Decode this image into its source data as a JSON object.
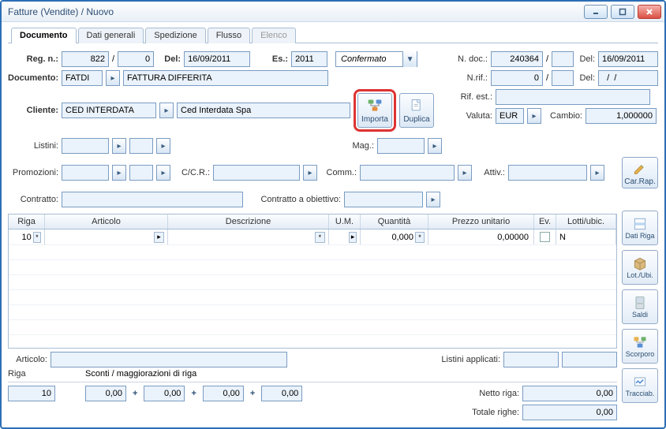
{
  "window": {
    "title": "Fatture  (Vendite) / Nuovo"
  },
  "tabs": {
    "documento": "Documento",
    "dati_generali": "Dati generali",
    "spedizione": "Spedizione",
    "flusso": "Flusso",
    "elenco": "Elenco"
  },
  "header": {
    "labels": {
      "reg_n": "Reg. n.:",
      "del": "Del:",
      "es": "Es.:",
      "documento": "Documento:",
      "cliente": "Cliente:",
      "n_doc": "N. doc.:",
      "n_rif": "N.rif.:",
      "rif_est": "Rif. est.:",
      "valuta": "Valuta:",
      "cambio": "Cambio:"
    },
    "reg_n": "822",
    "reg_n2": "0",
    "del": "16/09/2011",
    "es": "2011",
    "stato": "Confermato",
    "documento_code": "FATDI",
    "documento_desc": "FATTURA DIFFERITA",
    "cliente_code": "CED INTERDATA",
    "cliente_desc": "Ced Interdata Spa",
    "n_doc": "240364",
    "n_doc2": "",
    "del2": "16/09/2011",
    "n_rif": "0",
    "n_rif2": "",
    "del3": "  /  /",
    "rif_est": "",
    "valuta": "EUR",
    "cambio": "1,000000",
    "buttons": {
      "importa": "Importa",
      "duplica": "Duplica"
    }
  },
  "mid": {
    "labels": {
      "listini": "Listini:",
      "mag": "Mag.:",
      "promozioni": "Promozioni:",
      "ccr": "C/C.R.:",
      "comm": "Comm.:",
      "attiv": "Attiv.:",
      "contratto": "Contratto:",
      "contratto_obj": "Contratto a obiettivo:",
      "car_rap": "Car.Rap."
    }
  },
  "grid": {
    "headers": {
      "riga": "Riga",
      "articolo": "Articolo",
      "descrizione": "Descrizione",
      "um": "U.M.",
      "quantita": "Quantità",
      "prezzo": "Prezzo unitario",
      "ev": "Ev.",
      "lotti": "Lotti/ubic."
    },
    "row": {
      "riga": "10",
      "articolo": "",
      "descrizione": "",
      "um": "",
      "quantita": "0,000",
      "prezzo": "0,00000",
      "ev": false,
      "lotti": "N"
    }
  },
  "tools": {
    "dati_riga": "Dati Riga",
    "lot_ubi": "Lot./Ubi.",
    "saldi": "Saldi",
    "scorporo": "Scorporo",
    "tracciab": "Tracciab."
  },
  "footer": {
    "labels": {
      "articolo": "Articolo:",
      "listini_app": "Listini applicati:",
      "riga": "Riga",
      "sconti": "Sconti / maggiorazioni di riga",
      "netto_riga": "Netto riga:",
      "totale_righe": "Totale righe:"
    },
    "articolo": "",
    "riga": "10",
    "s1": "0,00",
    "s2": "0,00",
    "s3": "0,00",
    "s4": "0,00",
    "netto_riga": "0,00",
    "totale_righe": "0,00"
  }
}
